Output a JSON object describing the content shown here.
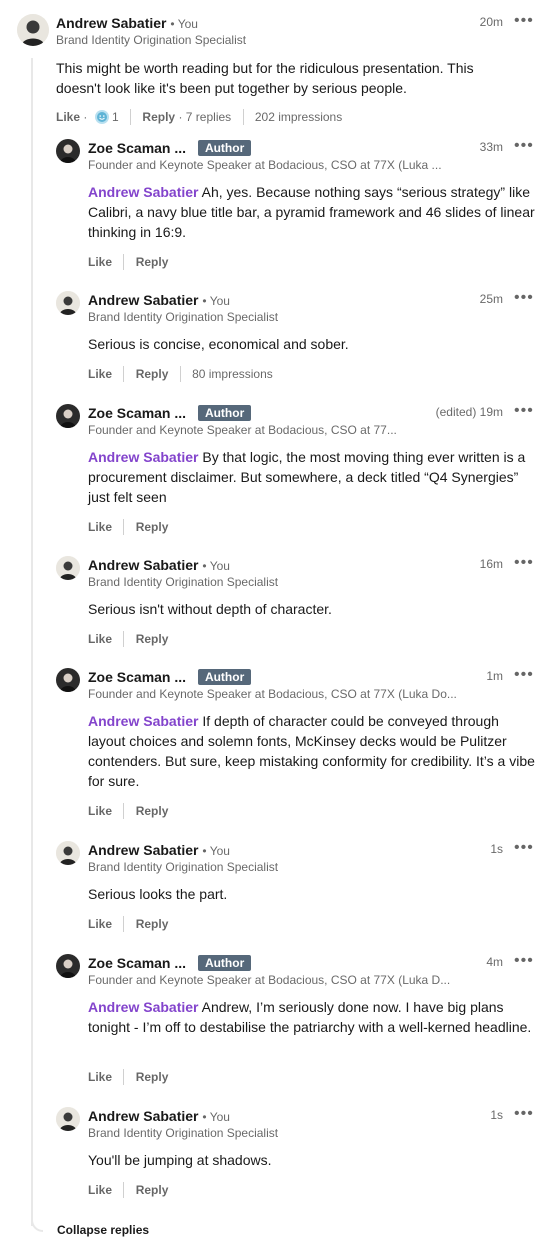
{
  "top_comment": {
    "name": "Andrew Sabatier",
    "you_tag": "• You",
    "headline": "Brand Identity Origination Specialist",
    "time": "20m",
    "text": "This might be worth reading but for the ridiculous presentation. This doesn't look like it's been put together by serious people.",
    "like_label": "Like",
    "reaction_count": "1",
    "reply_label": "Reply",
    "replies_count": "7 replies",
    "impressions": "202 impressions"
  },
  "replies": [
    {
      "name": "Zoe Scaman ...",
      "badge": "Author",
      "headline": "Founder and Keynote Speaker at Bodacious, CSO at 77X (Luka ...",
      "time": "33m",
      "mention": "Andrew Sabatier",
      "text": "Ah, yes. Because nothing says “serious strategy” like Calibri, a navy blue title bar, a pyramid framework and 46 slides of linear thinking in 16:9.",
      "like_label": "Like",
      "reply_label": "Reply"
    },
    {
      "name": "Andrew Sabatier",
      "you_tag": "• You",
      "headline": "Brand Identity Origination Specialist",
      "time": "25m",
      "text": "Serious is concise, economical and sober.",
      "like_label": "Like",
      "reply_label": "Reply",
      "impressions": "80 impressions"
    },
    {
      "name": "Zoe Scaman ...",
      "badge": "Author",
      "headline": "Founder and Keynote Speaker at Bodacious, CSO at 77...",
      "time": "(edited) 19m",
      "mention": "Andrew Sabatier",
      "text": "By that logic, the most moving thing ever written is a procurement disclaimer. But somewhere, a deck titled “Q4 Synergies” just felt seen",
      "like_label": "Like",
      "reply_label": "Reply"
    },
    {
      "name": "Andrew Sabatier",
      "you_tag": "• You",
      "headline": "Brand Identity Origination Specialist",
      "time": "16m",
      "text": "Serious isn't without depth of character.",
      "like_label": "Like",
      "reply_label": "Reply"
    },
    {
      "name": "Zoe Scaman ...",
      "badge": "Author",
      "headline": "Founder and Keynote Speaker at Bodacious, CSO at 77X (Luka Do...",
      "time": "1m",
      "mention": "Andrew Sabatier",
      "text": "If depth of character could be conveyed through layout choices and solemn fonts, McKinsey decks would be Pulitzer contenders. But sure, keep mistaking conformity for credibility. It’s a vibe for sure.",
      "like_label": "Like",
      "reply_label": "Reply"
    },
    {
      "name": "Andrew Sabatier",
      "you_tag": "• You",
      "headline": "Brand Identity Origination Specialist",
      "time": "1s",
      "text": "Serious looks the part.",
      "like_label": "Like",
      "reply_label": "Reply"
    },
    {
      "name": "Zoe Scaman ...",
      "badge": "Author",
      "headline": "Founder and Keynote Speaker at Bodacious, CSO at 77X (Luka D...",
      "time": "4m",
      "mention": "Andrew Sabatier",
      "text": "Andrew, I’m seriously done now. I have big plans tonight - I’m off to destabilise the patriarchy with a well-kerned headline.",
      "like_label": "Like",
      "reply_label": "Reply"
    },
    {
      "name": "Andrew Sabatier",
      "you_tag": "• You",
      "headline": "Brand Identity Origination Specialist",
      "time": "1s",
      "text": "You'll be jumping at shadows.",
      "like_label": "Like",
      "reply_label": "Reply"
    }
  ],
  "more_icon": "ellipsis-icon",
  "collapse_label": "Collapse replies",
  "colors": {
    "mention": "#8344cc",
    "badge": "#56687a"
  }
}
